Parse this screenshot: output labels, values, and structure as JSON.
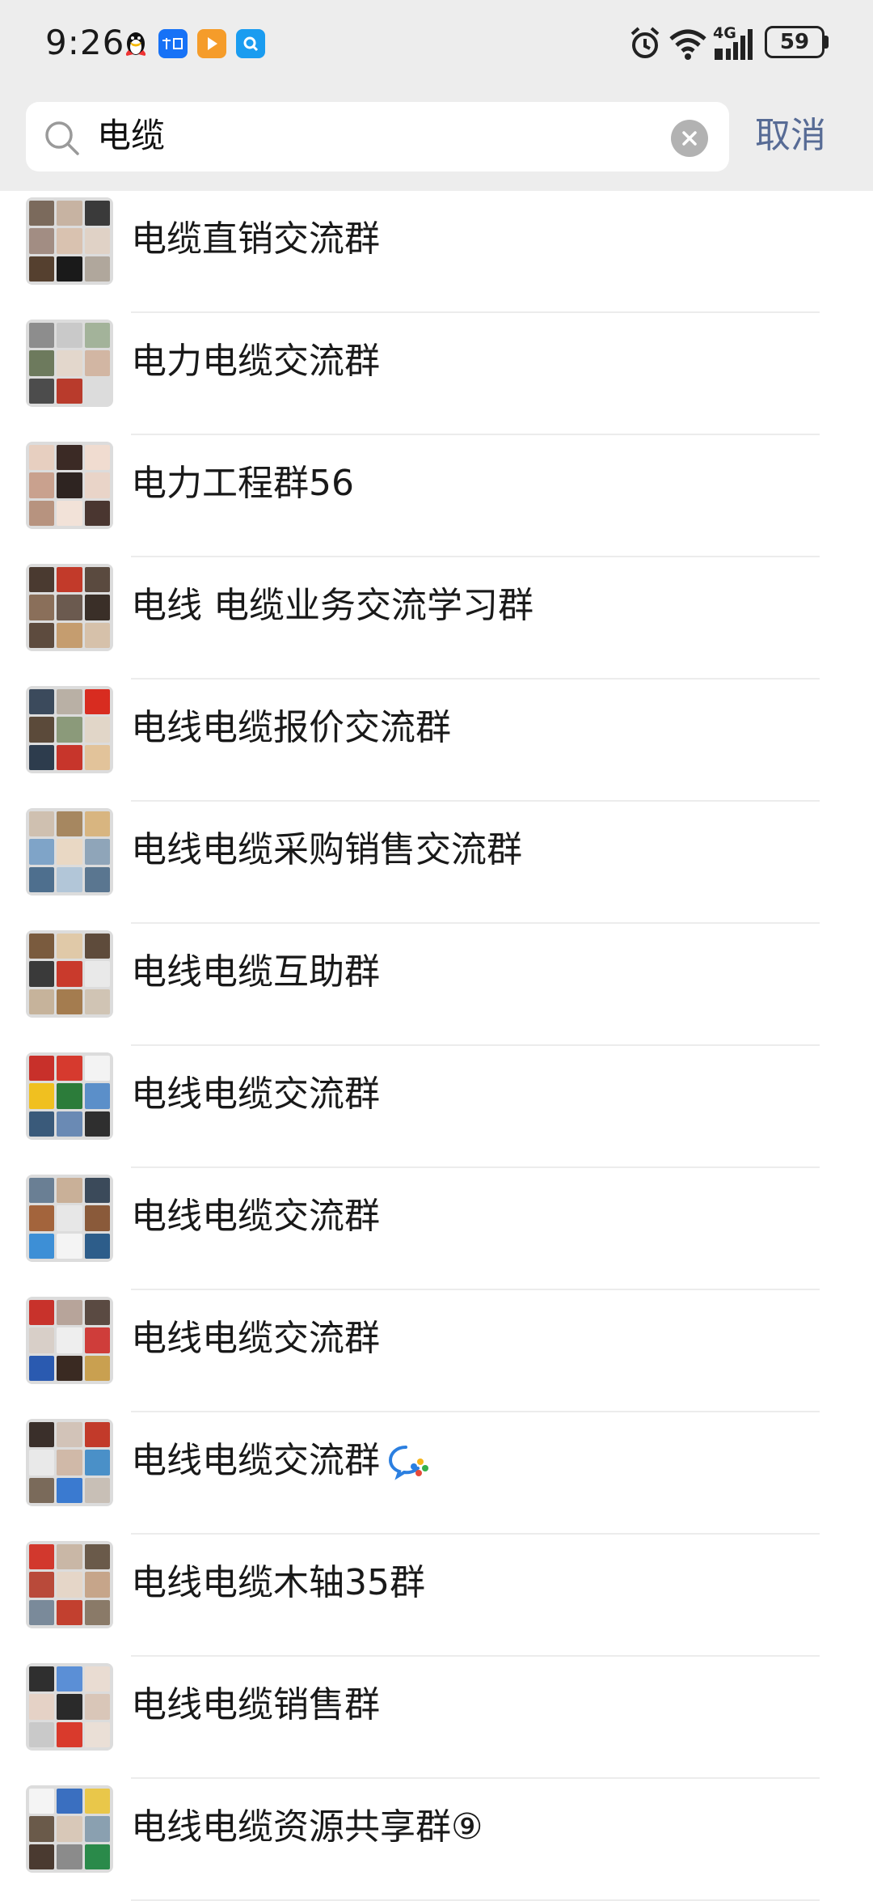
{
  "status_bar": {
    "time": "9:26",
    "network": "4G",
    "battery": "59",
    "app_icons": [
      "qq-icon",
      "zhihu-icon",
      "video-app-icon",
      "browser-app-icon"
    ]
  },
  "search": {
    "query": "电缆",
    "cancel_label": "取消"
  },
  "results": [
    {
      "title": "电缆直销交流群",
      "badge": false
    },
    {
      "title": "电力电缆交流群",
      "badge": false
    },
    {
      "title": "电力工程群56",
      "badge": false
    },
    {
      "title": "电线 电缆业务交流学习群",
      "badge": false
    },
    {
      "title": "电线电缆报价交流群",
      "badge": false
    },
    {
      "title": "电线电缆采购销售交流群",
      "badge": false
    },
    {
      "title": "电线电缆互助群",
      "badge": false
    },
    {
      "title": "电线电缆交流群",
      "badge": false
    },
    {
      "title": "电线电缆交流群",
      "badge": false
    },
    {
      "title": "电线电缆交流群",
      "badge": false
    },
    {
      "title": "电线电缆交流群",
      "badge": true
    },
    {
      "title": "电线电缆木轴35群",
      "badge": false
    },
    {
      "title": "电线电缆销售群",
      "badge": false
    },
    {
      "title": "电线电缆资源共享群⑨",
      "badge": false
    }
  ],
  "colors": {
    "background": "#ededed",
    "accent_link": "#576b95",
    "text": "#191919"
  }
}
